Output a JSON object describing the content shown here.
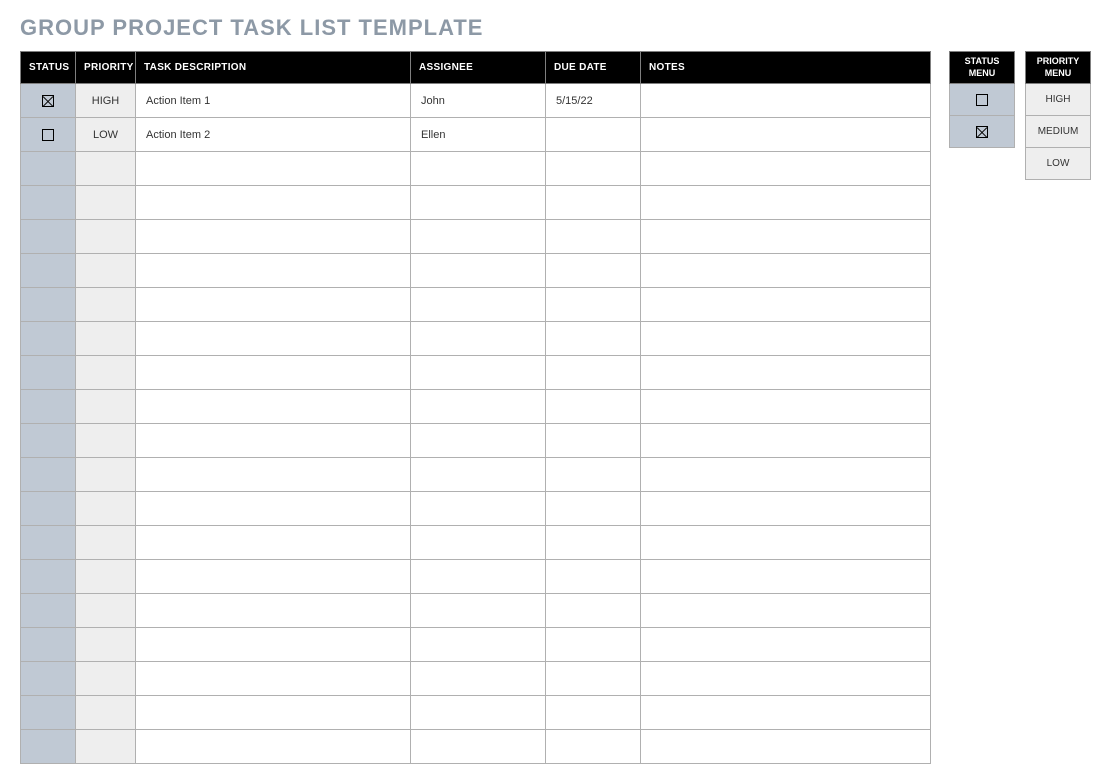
{
  "title": "GROUP PROJECT TASK LIST TEMPLATE",
  "headers": {
    "status": "STATUS",
    "priority": "PRIORITY",
    "task": "TASK DESCRIPTION",
    "assignee": "ASSIGNEE",
    "dueDate": "DUE DATE",
    "notes": "NOTES"
  },
  "rows": [
    {
      "status": "checked",
      "priority": "HIGH",
      "task": "Action Item 1",
      "assignee": "John",
      "dueDate": "5/15/22",
      "notes": ""
    },
    {
      "status": "unchecked",
      "priority": "LOW",
      "task": "Action Item 2",
      "assignee": "Ellen",
      "dueDate": "",
      "notes": ""
    },
    {
      "status": "",
      "priority": "",
      "task": "",
      "assignee": "",
      "dueDate": "",
      "notes": ""
    },
    {
      "status": "",
      "priority": "",
      "task": "",
      "assignee": "",
      "dueDate": "",
      "notes": ""
    },
    {
      "status": "",
      "priority": "",
      "task": "",
      "assignee": "",
      "dueDate": "",
      "notes": ""
    },
    {
      "status": "",
      "priority": "",
      "task": "",
      "assignee": "",
      "dueDate": "",
      "notes": ""
    },
    {
      "status": "",
      "priority": "",
      "task": "",
      "assignee": "",
      "dueDate": "",
      "notes": ""
    },
    {
      "status": "",
      "priority": "",
      "task": "",
      "assignee": "",
      "dueDate": "",
      "notes": ""
    },
    {
      "status": "",
      "priority": "",
      "task": "",
      "assignee": "",
      "dueDate": "",
      "notes": ""
    },
    {
      "status": "",
      "priority": "",
      "task": "",
      "assignee": "",
      "dueDate": "",
      "notes": ""
    },
    {
      "status": "",
      "priority": "",
      "task": "",
      "assignee": "",
      "dueDate": "",
      "notes": ""
    },
    {
      "status": "",
      "priority": "",
      "task": "",
      "assignee": "",
      "dueDate": "",
      "notes": ""
    },
    {
      "status": "",
      "priority": "",
      "task": "",
      "assignee": "",
      "dueDate": "",
      "notes": ""
    },
    {
      "status": "",
      "priority": "",
      "task": "",
      "assignee": "",
      "dueDate": "",
      "notes": ""
    },
    {
      "status": "",
      "priority": "",
      "task": "",
      "assignee": "",
      "dueDate": "",
      "notes": ""
    },
    {
      "status": "",
      "priority": "",
      "task": "",
      "assignee": "",
      "dueDate": "",
      "notes": ""
    },
    {
      "status": "",
      "priority": "",
      "task": "",
      "assignee": "",
      "dueDate": "",
      "notes": ""
    },
    {
      "status": "",
      "priority": "",
      "task": "",
      "assignee": "",
      "dueDate": "",
      "notes": ""
    },
    {
      "status": "",
      "priority": "",
      "task": "",
      "assignee": "",
      "dueDate": "",
      "notes": ""
    },
    {
      "status": "",
      "priority": "",
      "task": "",
      "assignee": "",
      "dueDate": "",
      "notes": ""
    }
  ],
  "statusMenu": {
    "header": "STATUS MENU",
    "items": [
      "unchecked",
      "checked"
    ]
  },
  "priorityMenu": {
    "header": "PRIORITY MENU",
    "items": [
      "HIGH",
      "MEDIUM",
      "LOW"
    ]
  }
}
